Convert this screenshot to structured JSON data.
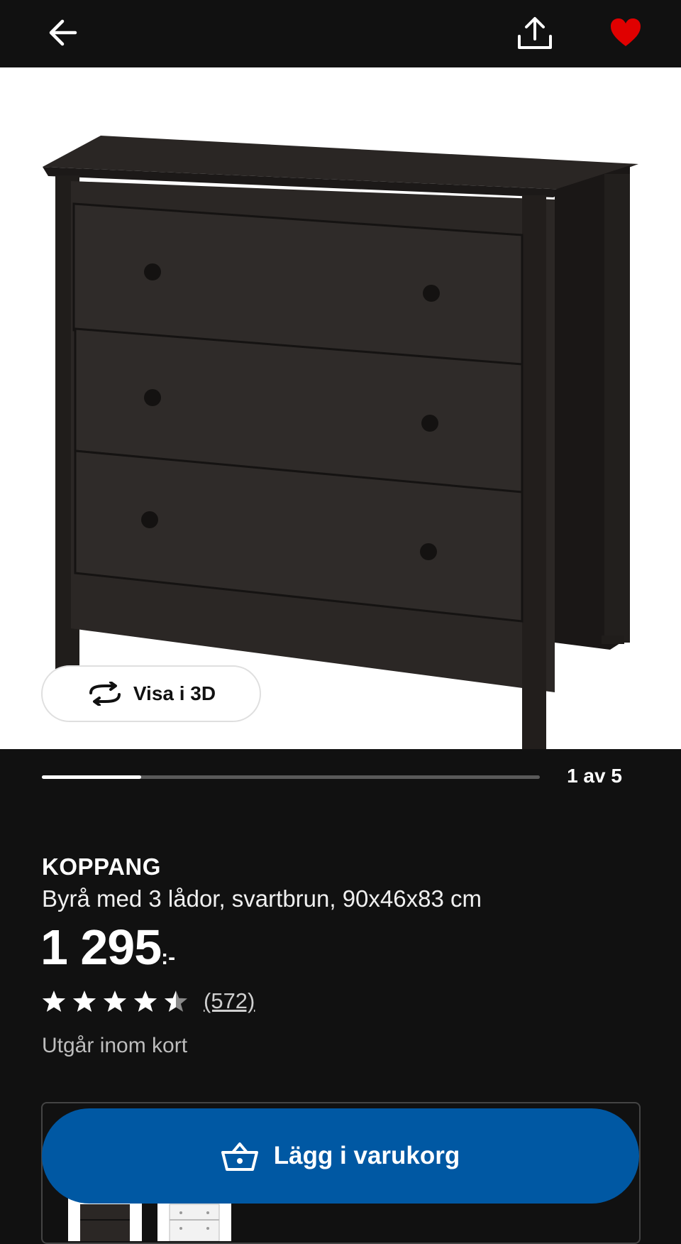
{
  "header": {
    "back_icon": "arrow-left-icon",
    "share_icon": "share-icon",
    "favourite_icon": "heart-icon",
    "favourite_color": "#e00000"
  },
  "gallery": {
    "view_3d_label": "Visa i 3D",
    "view_3d_icon": "rotate-icon",
    "progress_fraction": 0.2,
    "counter": "1 av 5"
  },
  "product": {
    "brand": "KOPPANG",
    "description": "Byrå med 3 lådor, svartbrun, 90x46x83 cm",
    "price": "1 295",
    "price_suffix": ":-",
    "rating": 4.5,
    "rating_max": 5,
    "review_count": "(572)",
    "availability": "Utgår inom kort"
  },
  "actions": {
    "add_to_cart_label": "Lägg i varukorg",
    "add_to_cart_icon": "basket-icon",
    "accent_color": "#0058a3"
  }
}
